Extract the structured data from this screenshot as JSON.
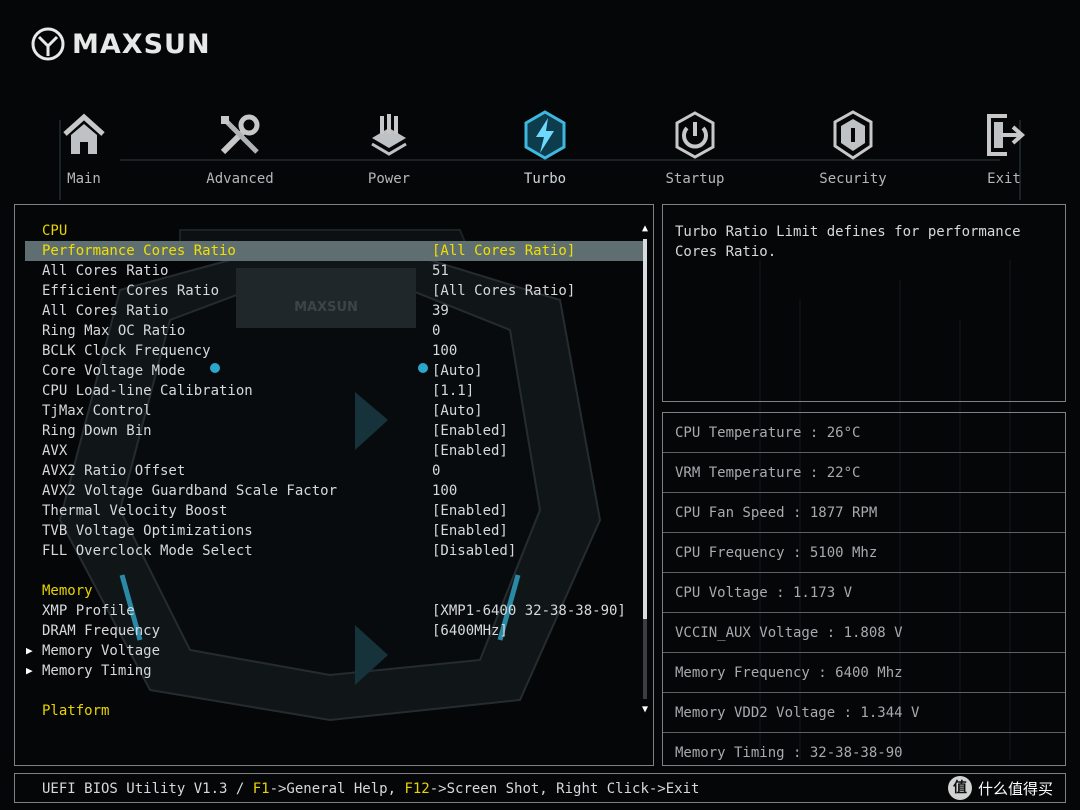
{
  "brand": {
    "name": "MAXSUN"
  },
  "nav": [
    {
      "id": "main",
      "label": "Main",
      "icon": "home-icon"
    },
    {
      "id": "advanced",
      "label": "Advanced",
      "icon": "tools-icon"
    },
    {
      "id": "power",
      "label": "Power",
      "icon": "power-chip-icon"
    },
    {
      "id": "turbo",
      "label": "Turbo",
      "icon": "turbo-bolt-icon",
      "active": true
    },
    {
      "id": "startup",
      "label": "Startup",
      "icon": "power-button-icon"
    },
    {
      "id": "security",
      "label": "Security",
      "icon": "shield-lock-icon"
    },
    {
      "id": "exit",
      "label": "Exit",
      "icon": "exit-door-icon"
    }
  ],
  "settings": [
    {
      "label": "CPU",
      "value": "",
      "type": "section"
    },
    {
      "label": "Performance Cores Ratio",
      "value": "[All Cores Ratio]",
      "selected": true
    },
    {
      "label": "All Cores Ratio",
      "value": "51"
    },
    {
      "label": "Efficient Cores Ratio",
      "value": "[All Cores Ratio]"
    },
    {
      "label": "All Cores Ratio",
      "value": "39"
    },
    {
      "label": "Ring Max OC Ratio",
      "value": "0"
    },
    {
      "label": "BCLK Clock Frequency",
      "value": "100"
    },
    {
      "label": "Core Voltage Mode",
      "value": "[Auto]"
    },
    {
      "label": "CPU Load-line Calibration",
      "value": "[1.1]"
    },
    {
      "label": "TjMax Control",
      "value": "[Auto]"
    },
    {
      "label": "Ring Down Bin",
      "value": "[Enabled]"
    },
    {
      "label": "AVX",
      "value": "[Enabled]"
    },
    {
      "label": "AVX2 Ratio Offset",
      "value": "0"
    },
    {
      "label": "AVX2 Voltage Guardband Scale Factor",
      "value": "100"
    },
    {
      "label": "Thermal Velocity Boost",
      "value": "[Enabled]"
    },
    {
      "label": "TVB Voltage Optimizations",
      "value": "[Enabled]"
    },
    {
      "label": "FLL Overclock Mode Select",
      "value": "[Disabled]"
    },
    {
      "label": "",
      "value": "",
      "type": "spacer"
    },
    {
      "label": "Memory",
      "value": "",
      "type": "section"
    },
    {
      "label": "XMP Profile",
      "value": "[XMP1-6400 32-38-38-90]"
    },
    {
      "label": "DRAM Frequency",
      "value": "[6400MHz]"
    },
    {
      "label": "Memory Voltage",
      "value": "",
      "submenu": true
    },
    {
      "label": "Memory Timing",
      "value": "",
      "submenu": true
    },
    {
      "label": "",
      "value": "",
      "type": "spacer"
    },
    {
      "label": "Platform",
      "value": "",
      "type": "section"
    }
  ],
  "scroll": {
    "up": "▲",
    "down": "▼",
    "position": 0.82
  },
  "help": {
    "text": "Turbo Ratio Limit defines for performance\nCores Ratio."
  },
  "monitor": [
    "CPU Temperature : 26°C",
    "VRM Temperature : 22°C",
    "CPU Fan Speed : 1877 RPM",
    "CPU Frequency : 5100 Mhz",
    "CPU Voltage : 1.173 V",
    "VCCIN_AUX Voltage : 1.808 V",
    "Memory Frequency : 6400 Mhz",
    "Memory VDD2 Voltage : 1.344 V",
    "Memory Timing : 32-38-38-90"
  ],
  "status": {
    "prefix": "UEFI BIOS Utility V1.3 / ",
    "f1_key": "F1",
    "f1_text": "->General Help, ",
    "f12_key": "F12",
    "f12_text": "->Screen Shot, Right Click->Exit"
  },
  "watermark": {
    "badge": "值",
    "text": "什么值得买"
  },
  "colors": {
    "section": "#e8d400",
    "selected_bg": "#5f6e70",
    "border": "#7d8285",
    "accent": "#3fb8e0"
  }
}
